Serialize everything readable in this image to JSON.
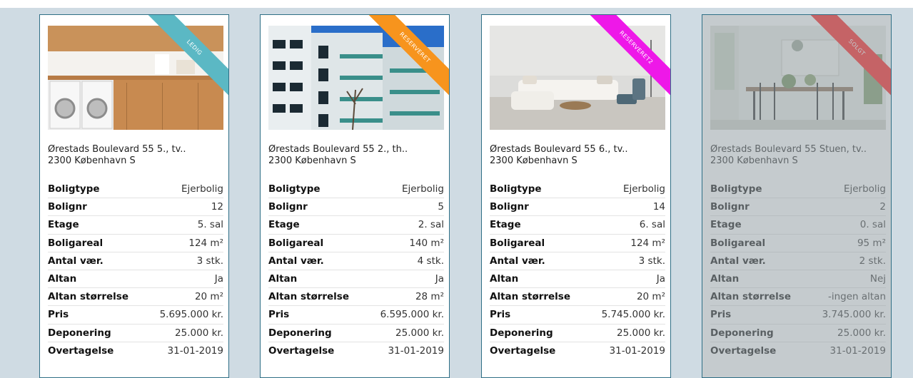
{
  "labels": {
    "type": "Boligtype",
    "nr": "Bolignr",
    "floor": "Etage",
    "area": "Boligareal",
    "rooms": "Antal vær.",
    "balcony": "Altan",
    "balcony_size": "Altan størrelse",
    "price": "Pris",
    "deposit": "Deponering",
    "takeover": "Overtagelse"
  },
  "cards": [
    {
      "status": "LEDIG",
      "status_color": "#5bb8c4",
      "photo": "laundry-room-photo",
      "address1": "Ørestads Boulevard 55 5., tv..",
      "address2": "2300 København S",
      "type": "Ejerbolig",
      "nr": "12",
      "floor": "5. sal",
      "area": "124 m²",
      "rooms": "3 stk.",
      "balcony": "Ja",
      "balcony_size": "20 m²",
      "price": "5.695.000 kr.",
      "deposit": "25.000 kr.",
      "takeover": "31-01-2019"
    },
    {
      "status": "RESERVERET",
      "status_color": "#f7941d",
      "photo": "apartment-building-photo",
      "address1": "Ørestads Boulevard 55 2., th..",
      "address2": "2300 København S",
      "type": "Ejerbolig",
      "nr": "5",
      "floor": "2. sal",
      "area": "140 m²",
      "rooms": "4 stk.",
      "balcony": "Ja",
      "balcony_size": "28 m²",
      "price": "6.595.000 kr.",
      "deposit": "25.000 kr.",
      "takeover": "31-01-2019"
    },
    {
      "status": "RESERVERET2",
      "status_color": "#ee18e8",
      "photo": "living-room-photo",
      "address1": "Ørestads Boulevard 55 6., tv..",
      "address2": "2300 København S",
      "type": "Ejerbolig",
      "nr": "14",
      "floor": "6. sal",
      "area": "124 m²",
      "rooms": "3 stk.",
      "balcony": "Ja",
      "balcony_size": "20 m²",
      "price": "5.745.000 kr.",
      "deposit": "25.000 kr.",
      "takeover": "31-01-2019"
    },
    {
      "status": "SOLGT",
      "status_color": "#ff1a1a",
      "photo": "dining-room-photo",
      "address1": "Ørestads Boulevard 55 Stuen, tv..",
      "address2": "2300 København S",
      "type": "Ejerbolig",
      "nr": "2",
      "floor": "0. sal",
      "area": "95 m²",
      "rooms": "2 stk.",
      "balcony": "Nej",
      "balcony_size": "-ingen altan",
      "price": "3.745.000 kr.",
      "deposit": "25.000 kr.",
      "takeover": "31-01-2019"
    }
  ]
}
